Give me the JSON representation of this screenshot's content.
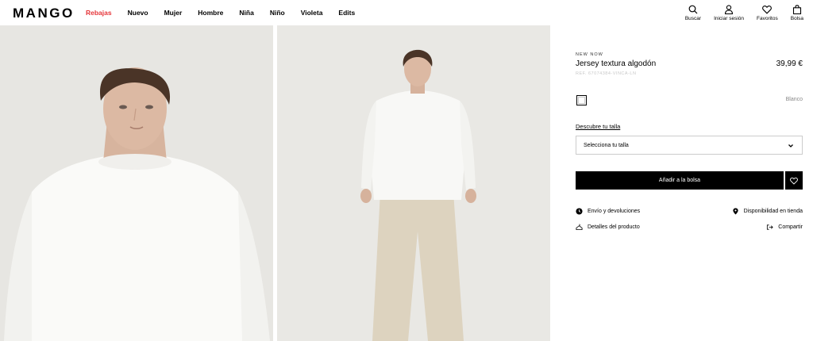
{
  "brand": {
    "logo": "MANGO"
  },
  "nav": {
    "items": [
      {
        "label": "Rebajas",
        "highlight": true
      },
      {
        "label": "Nuevo",
        "highlight": false
      },
      {
        "label": "Mujer",
        "highlight": false
      },
      {
        "label": "Hombre",
        "highlight": false
      },
      {
        "label": "Niña",
        "highlight": false
      },
      {
        "label": "Niño",
        "highlight": false
      },
      {
        "label": "Violeta",
        "highlight": false
      },
      {
        "label": "Edits",
        "highlight": false
      }
    ]
  },
  "header_actions": {
    "search": "Buscar",
    "login": "Iniciar sesión",
    "favorites": "Favoritos",
    "bag": "Bolsa"
  },
  "product": {
    "eyebrow": "NEW NOW",
    "name": "Jersey textura algodón",
    "price": "39,99 €",
    "ref": "REF. 67074384-VINCA-LN",
    "color": {
      "name": "Blanco",
      "swatch": "#ffffff"
    },
    "size_guide": "Descubre tu talla",
    "size_placeholder": "Selecciona tu talla",
    "add_to_bag": "Añadir a la bolsa"
  },
  "links": {
    "shipping": "Envío y devoluciones",
    "store_availability": "Disponibilidad en tienda",
    "details": "Detalles del producto",
    "share": "Compartir"
  },
  "colors": {
    "sale_red": "#e5363a",
    "button_black": "#000000",
    "photo_bg": "#e7e6e2"
  }
}
